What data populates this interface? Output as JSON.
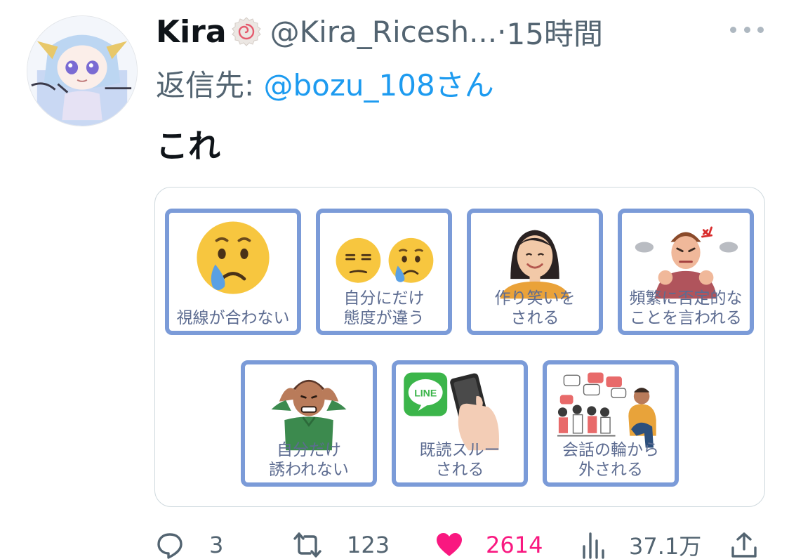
{
  "tweet": {
    "author_name": "Kira",
    "handle": "@Kira_Ricesh...",
    "time_separator": "·",
    "time": "15時間",
    "reply_prefix": "返信先: ",
    "reply_to": "@bozu_108さん",
    "text": "これ"
  },
  "media": {
    "cards_row1": [
      {
        "lines": [
          "視線が合わない"
        ],
        "icon": "crying-face-icon"
      },
      {
        "lines": [
          "自分にだけ",
          "態度が違う"
        ],
        "icon": "unamused-and-sad-face-icon"
      },
      {
        "lines": [
          "作り笑いを",
          "される"
        ],
        "icon": "smiling-woman-icon"
      },
      {
        "lines": [
          "頻繁に否定的な",
          "ことを言われる"
        ],
        "icon": "angry-man-icon"
      }
    ],
    "cards_row2": [
      {
        "lines": [
          "自分だけ",
          "誘われない"
        ],
        "icon": "stressed-man-icon"
      },
      {
        "lines": [
          "既読スルー",
          "される"
        ],
        "icon": "phone-line-app-icon"
      },
      {
        "lines": [
          "会話の輪から",
          "外される"
        ],
        "icon": "excluded-person-icon"
      }
    ],
    "line_logo_text": "LINE"
  },
  "actions": {
    "replies": "3",
    "retweets": "123",
    "likes": "2614",
    "views": "37.1万"
  },
  "colors": {
    "text_primary": "#0f1419",
    "text_secondary": "#536471",
    "link": "#1d9bf0",
    "like": "#f91880",
    "card_border": "#7b9bd8"
  }
}
